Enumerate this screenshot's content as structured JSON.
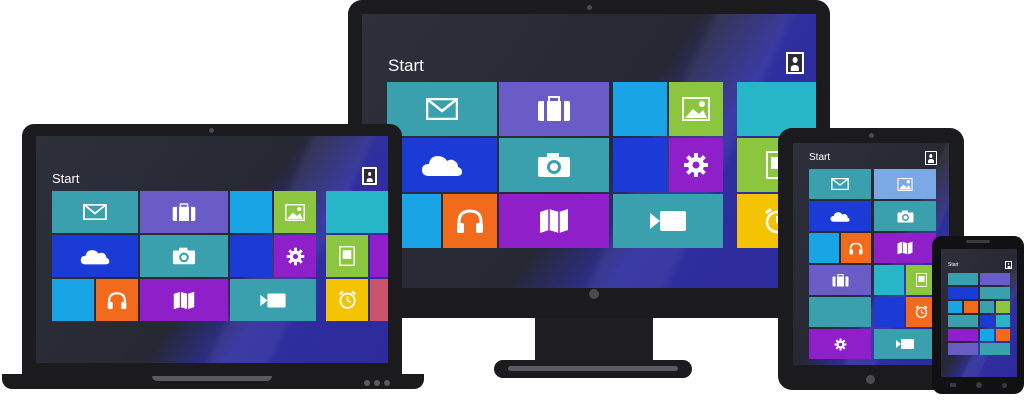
{
  "colors": {
    "teal": "#3aa0ad",
    "purple": "#6a5cc7",
    "blue": "#1a3bd6",
    "lime": "#8cc63e",
    "orange": "#f26b1d",
    "violet": "#8f1fc9",
    "yellow": "#f5c400",
    "skyblue": "#19a4e6",
    "cyan": "#27b6c8",
    "lightblue": "#7aa9e6"
  },
  "devices": {
    "monitor": {
      "start_label": "Start"
    },
    "laptop": {
      "start_label": "Start"
    },
    "tablet": {
      "start_label": "Start"
    },
    "phone": {
      "start_label": "Start"
    }
  }
}
